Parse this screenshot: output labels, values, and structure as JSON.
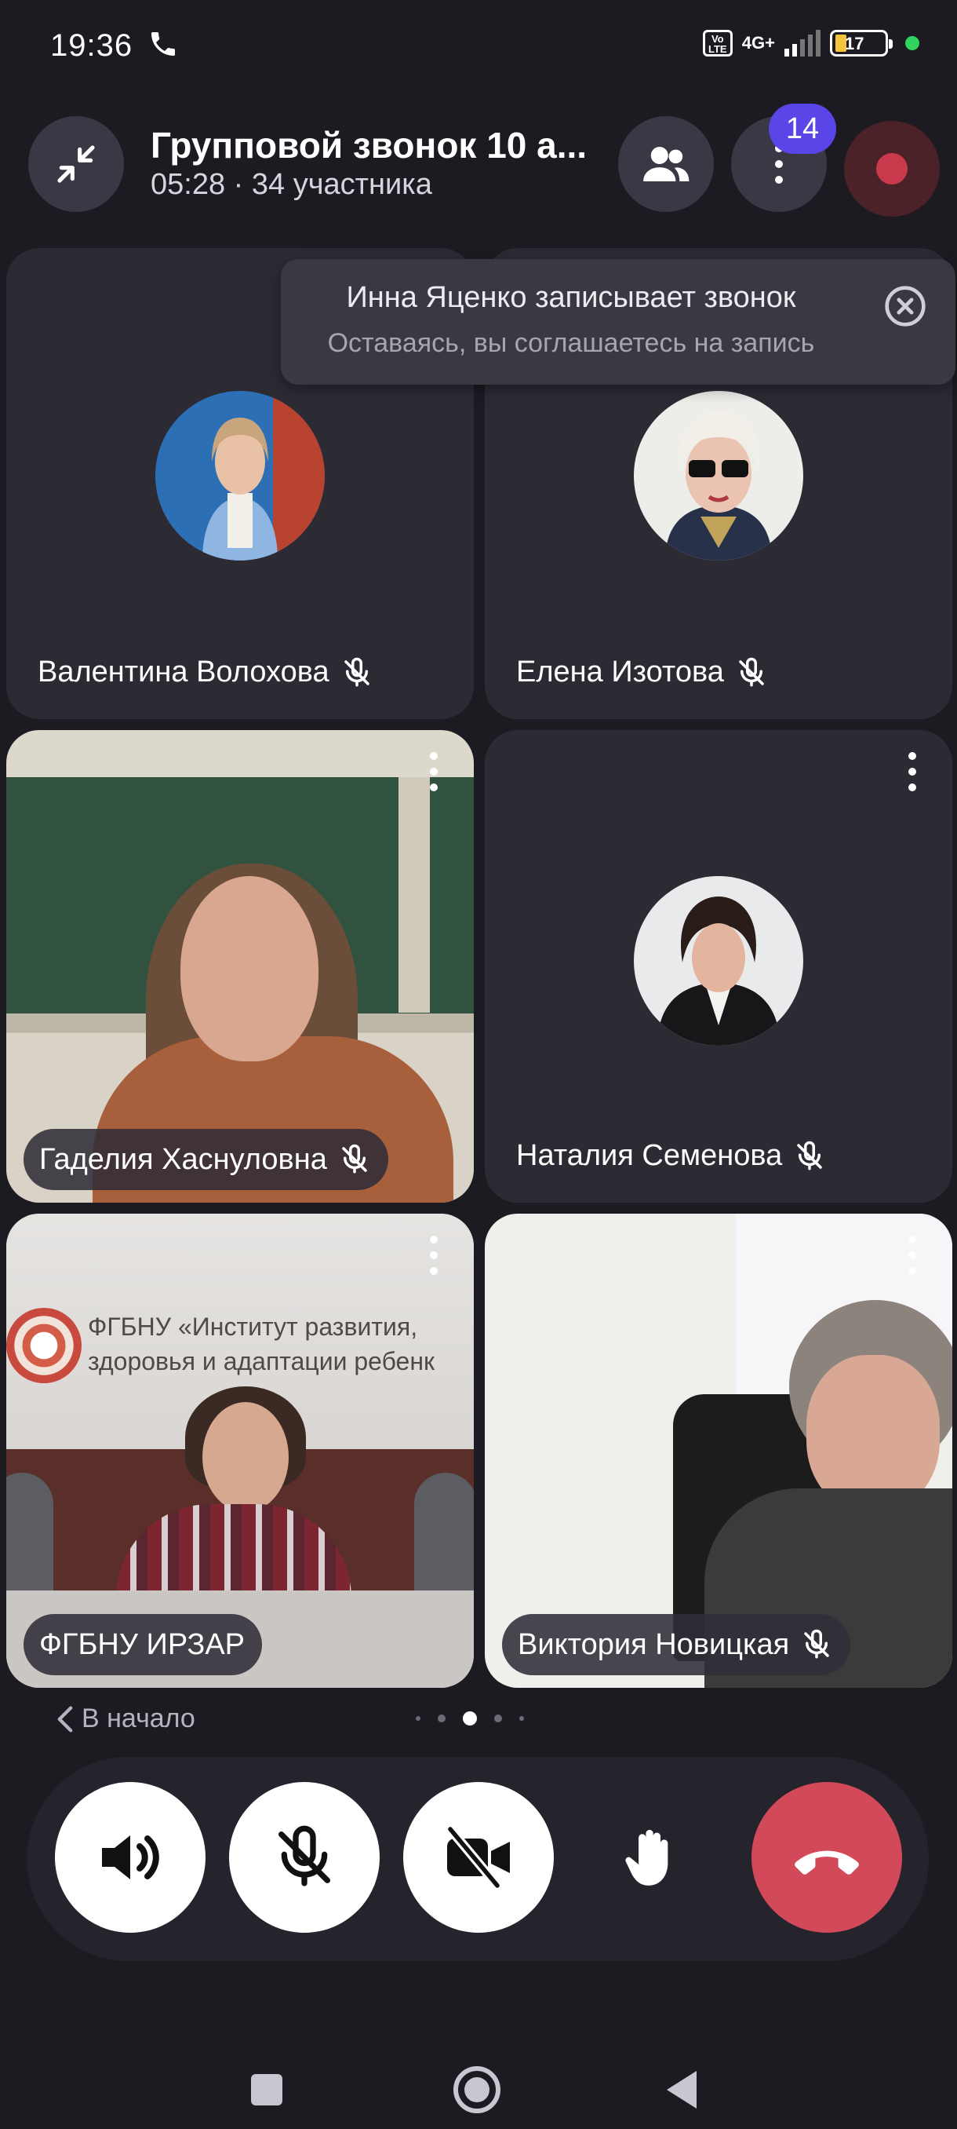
{
  "status_bar": {
    "time": "19:36",
    "network": "4G+",
    "volte": "Vo LTE",
    "battery": "17"
  },
  "header": {
    "title": "Групповой звонок 10 а...",
    "subtitle": "05:28 · 34 участника",
    "more_badge": "14",
    "icons": [
      "minimize-icon",
      "people-icon",
      "more-vertical-icon",
      "record-icon"
    ]
  },
  "recording_notice": {
    "title": "Инна Яценко записывает звонок",
    "subtitle": "Оставаясь, вы соглашаетесь на запись"
  },
  "participants": [
    {
      "name": "Валентина Волохова",
      "muted": true,
      "media": "avatar"
    },
    {
      "name": "Елена Изотова",
      "muted": true,
      "media": "avatar"
    },
    {
      "name": "Гаделия Хаснуловна",
      "muted": true,
      "media": "video"
    },
    {
      "name": "Наталия Семенова",
      "muted": true,
      "media": "avatar"
    },
    {
      "name": "ФГБНУ ИРЗАР",
      "muted": false,
      "media": "video"
    },
    {
      "name": "Виктория Новицкая",
      "muted": true,
      "media": "video"
    }
  ],
  "video_overlay_text": {
    "line1": "ФГБНУ «Институт развития,",
    "line2": "здоровья и адаптации ребенк"
  },
  "pager": {
    "back_label": "В начало",
    "page_count": 5,
    "current_page": 3
  },
  "controls": {
    "buttons": [
      "speaker-icon",
      "mic-off-icon",
      "video-off-icon",
      "raise-hand-icon",
      "end-call-icon"
    ],
    "end_call_color": "#d2495a"
  },
  "colors": {
    "background": "#1d1b22",
    "tile": "#2c2a33",
    "badge": "#5a45e6",
    "record": "#c83a4b"
  }
}
